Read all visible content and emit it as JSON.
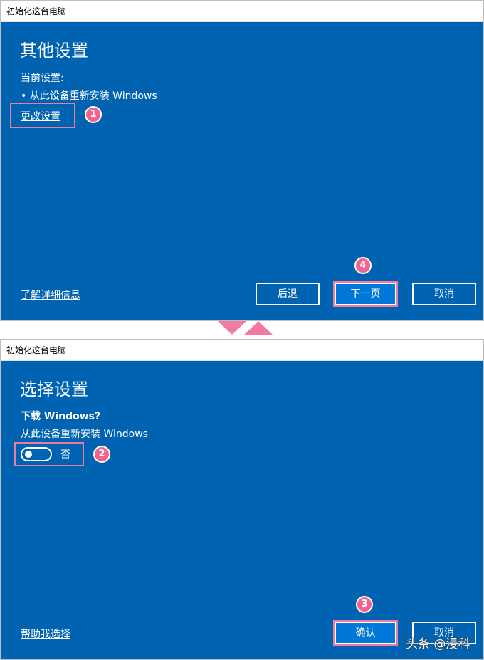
{
  "panel1": {
    "title": "初始化这台电脑",
    "heading": "其他设置",
    "current_settings_label": "当前设置:",
    "bullet_item": "•  从此设备重新安装 Windows",
    "change_settings_link": "更改设置",
    "learn_more_link": "了解详细信息",
    "back_button": "后退",
    "next_button": "下一页",
    "cancel_button": "取消",
    "badge_change": "1",
    "badge_next": "4"
  },
  "panel2": {
    "title": "初始化这台电脑",
    "heading": "选择设置",
    "question": "下载 Windows?",
    "description": "从此设备重新安装 Windows",
    "toggle_label": "否",
    "help_link": "帮助我选择",
    "confirm_button": "确认",
    "cancel_button": "取消",
    "badge_toggle": "2",
    "badge_confirm": "3"
  },
  "watermark": "头条 @浸科",
  "colors": {
    "window_bg": "#0063b1",
    "primary_button": "#0078d7",
    "highlight": "#f07aa0",
    "badge": "#f2648f"
  }
}
